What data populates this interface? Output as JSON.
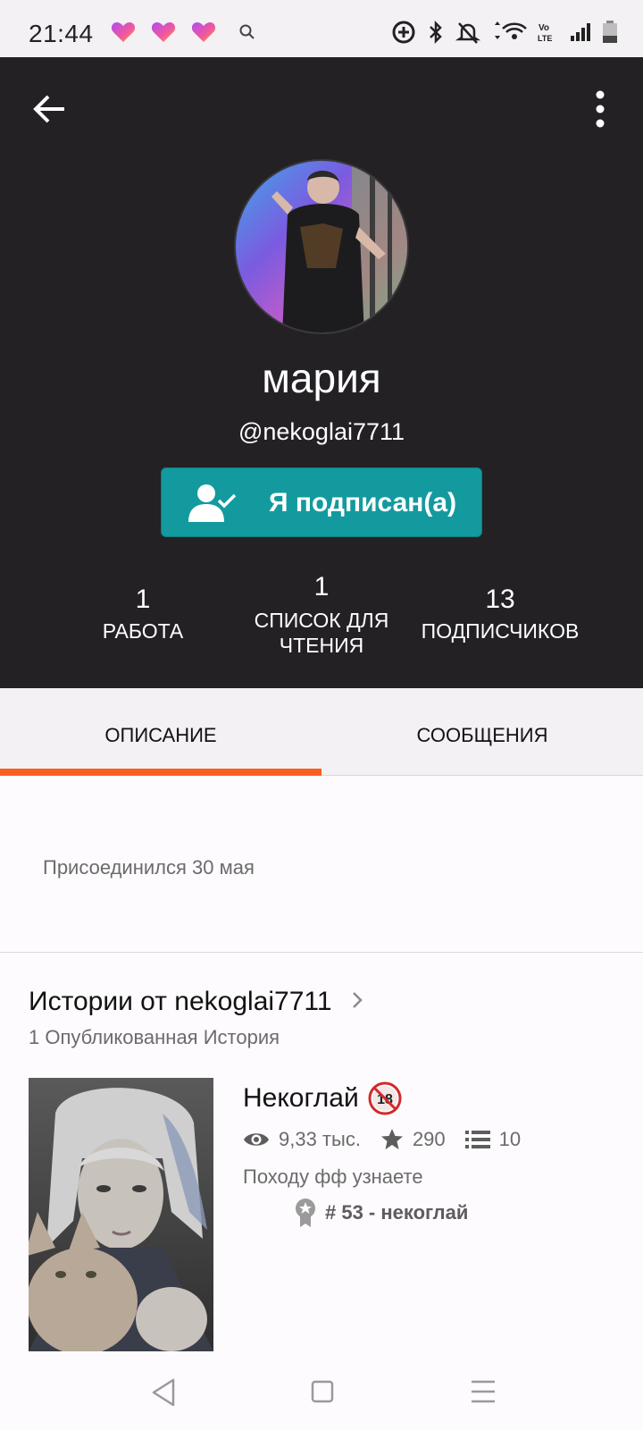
{
  "status_bar": {
    "time": "21:44",
    "icons": [
      "heart-app-icon",
      "heart-app-icon",
      "heart-app-icon",
      "search-icon",
      "data-saver-icon",
      "bluetooth-icon",
      "mute-icon",
      "wifi-icon",
      "volte-icon",
      "signal-icon",
      "battery-icon"
    ],
    "volte_label": "Vo LTE"
  },
  "header": {
    "display_name": "мария",
    "username": "@nekoglai7711",
    "follow_button_label": "Я подписан(а)",
    "accent_color": "#139a9e",
    "stats": {
      "works": {
        "value": "1",
        "label": "РАБОТА"
      },
      "reading_list": {
        "value": "1",
        "label_line1": "СПИСОК ДЛЯ",
        "label_line2": "ЧТЕНИЯ"
      },
      "followers": {
        "value": "13",
        "label": "ПОДПИСЧИКОВ"
      }
    }
  },
  "tabs": {
    "description": "ОПИСАНИЕ",
    "messages": "СООБЩЕНИЯ",
    "active": "description",
    "indicator_color": "#f9601f"
  },
  "about": {
    "joined": "Присоединился 30 мая"
  },
  "stories": {
    "title": "Истории от nekoglai7711",
    "count_text": "1 Опубликованная История",
    "items": [
      {
        "title": "Некоглай",
        "age_badge": "18",
        "reads": "9,33 тыс.",
        "votes": "290",
        "parts": "10",
        "description": "Походу фф узнаете",
        "rank": "# 53 - некоглай"
      }
    ]
  },
  "navigation_bar": {
    "buttons": [
      "back",
      "home",
      "recent-apps"
    ]
  }
}
